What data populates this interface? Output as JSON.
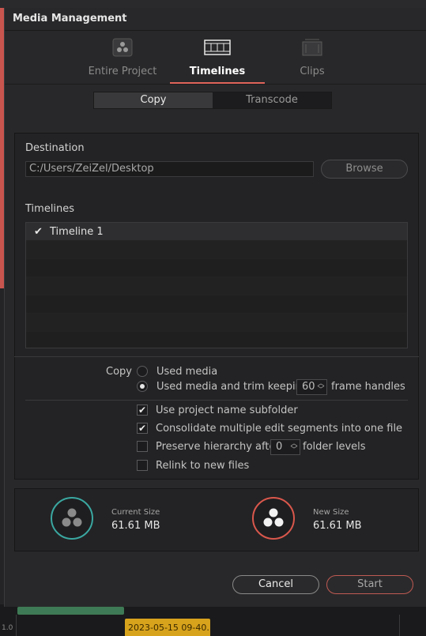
{
  "background": {
    "timeline_clip_label": "2023-05-15 09-40...",
    "timeline_ruler_label": "1.0"
  },
  "dialog": {
    "title": "Media Management",
    "tabs": [
      {
        "label": "Entire Project",
        "icon": "resolve-logo-icon",
        "active": false
      },
      {
        "label": "Timelines",
        "icon": "timeline-filmstrip-icon",
        "active": true
      },
      {
        "label": "Clips",
        "icon": "clips-icon",
        "active": false
      }
    ],
    "mode": {
      "options": [
        "Copy",
        "Transcode"
      ],
      "selected": "Copy"
    },
    "destination": {
      "label": "Destination",
      "path": "C:/Users/ZeiZel/Desktop",
      "browse_label": "Browse"
    },
    "timelines": {
      "label": "Timelines",
      "items": [
        {
          "name": "Timeline 1",
          "checked": true
        }
      ]
    },
    "copy": {
      "label": "Copy",
      "options": [
        {
          "label": "Used media",
          "selected": false
        },
        {
          "label": "Used media and trim keeping",
          "selected": true,
          "value": "60",
          "suffix": "frame handles"
        }
      ]
    },
    "checks": [
      {
        "label": "Use project name subfolder",
        "checked": true
      },
      {
        "label": "Consolidate multiple edit segments into one file",
        "checked": true
      },
      {
        "label": "Preserve hierarchy after",
        "checked": false,
        "value": "0",
        "suffix": "folder levels"
      },
      {
        "label": "Relink to new files",
        "checked": false
      }
    ],
    "sizes": {
      "current": {
        "label": "Current Size",
        "value": "61.61 MB",
        "ring_color": "#3aa7a0"
      },
      "new": {
        "label": "New Size",
        "value": "61.61 MB",
        "ring_color": "#d9574c"
      }
    },
    "buttons": {
      "cancel": "Cancel",
      "start": "Start"
    },
    "accent_color": "#e0655a"
  }
}
